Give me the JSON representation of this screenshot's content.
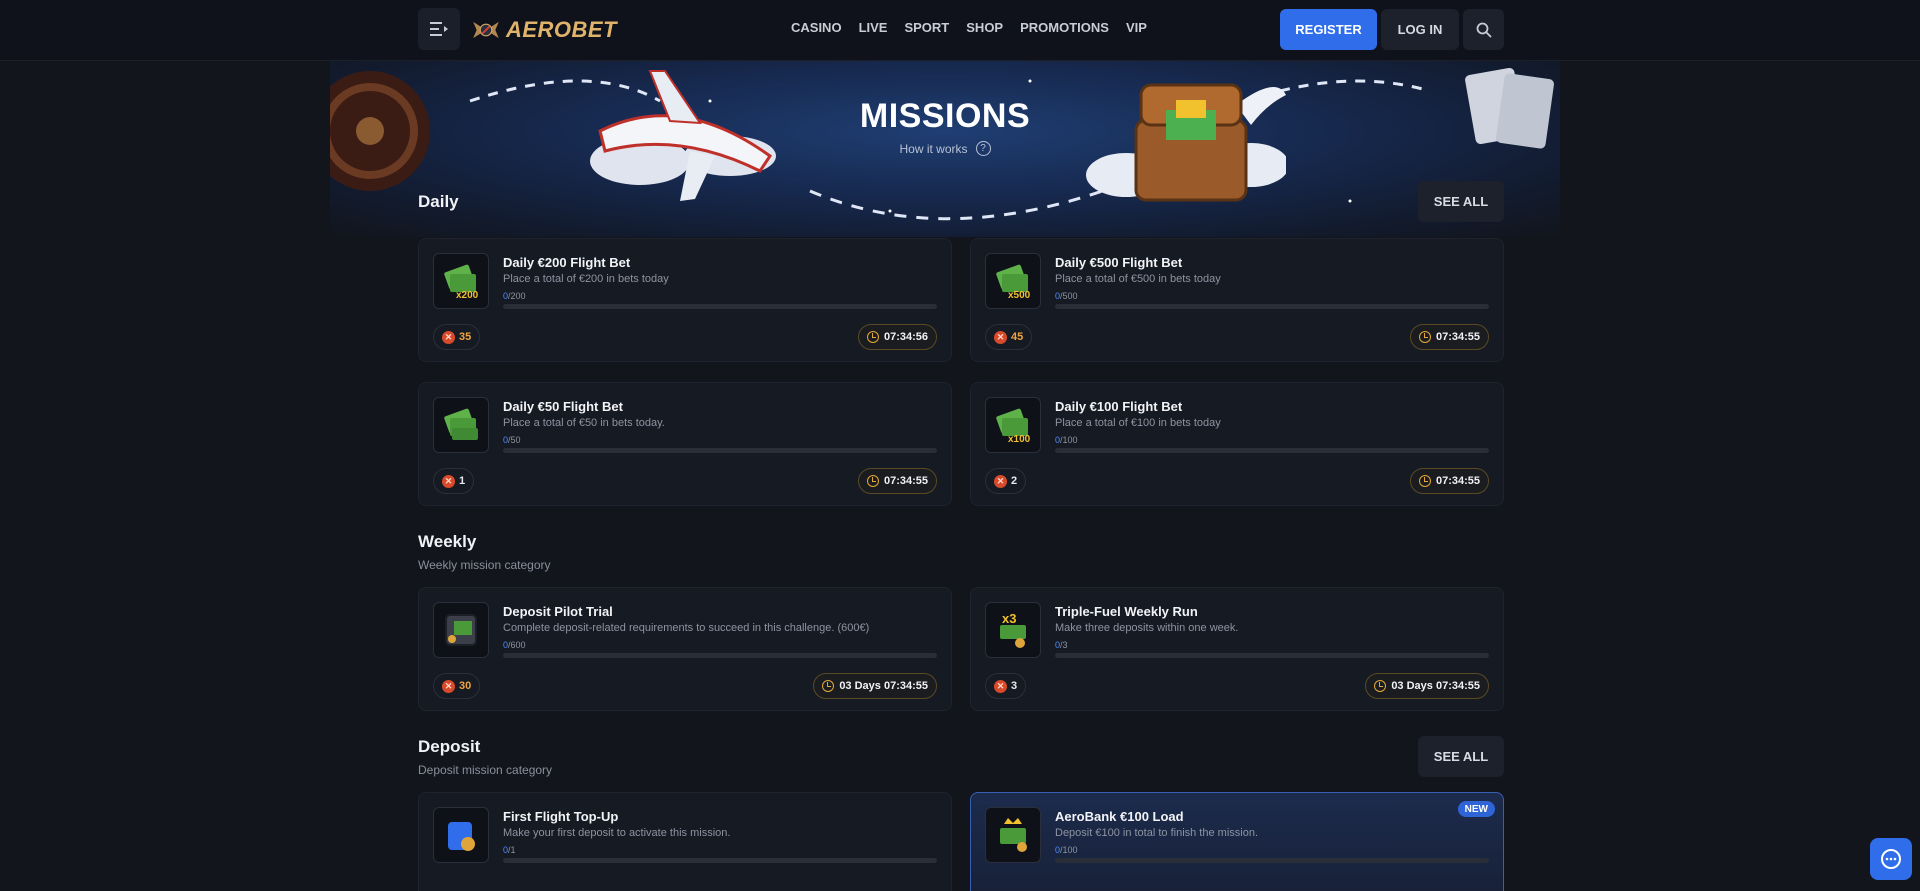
{
  "header": {
    "brand": "AEROBET",
    "nav": [
      "CASINO",
      "LIVE",
      "SPORT",
      "SHOP",
      "PROMOTIONS",
      "VIP"
    ],
    "register_label": "REGISTER",
    "login_label": "LOG IN"
  },
  "hero": {
    "title": "MISSIONS",
    "how_it_works": "How it works"
  },
  "sections": {
    "daily": {
      "title": "Daily",
      "see_all": "SEE ALL",
      "cards": [
        {
          "title": "Daily €200 Flight Bet",
          "desc": "Place a total of €200 in bets today",
          "done": "0",
          "total": "/200",
          "progress": 0,
          "points": "35",
          "timer": "07:34:56",
          "icon": "cash-x200-icon",
          "multiplier": "x200"
        },
        {
          "title": "Daily €500 Flight Bet",
          "desc": "Place a total of €500 in bets today",
          "done": "0",
          "total": "/500",
          "progress": 0,
          "points": "45",
          "timer": "07:34:55",
          "icon": "cash-x500-icon",
          "multiplier": "x500"
        },
        {
          "title": "Daily €50 Flight Bet",
          "desc": "Place a total of €50 in bets today.",
          "done": "0",
          "total": "/50",
          "progress": 0,
          "points": "1",
          "timer": "07:34:55",
          "icon": "cash-stack-icon",
          "multiplier": ""
        },
        {
          "title": "Daily €100 Flight Bet",
          "desc": "Place a total of €100 in bets today",
          "done": "0",
          "total": "/100",
          "progress": 0,
          "points": "2",
          "timer": "07:34:55",
          "icon": "cash-x100-icon",
          "multiplier": "x100"
        }
      ]
    },
    "weekly": {
      "title": "Weekly",
      "subtitle": "Weekly mission category",
      "cards": [
        {
          "title": "Deposit Pilot Trial",
          "desc": "Complete deposit-related requirements to succeed in this challenge. (600€)",
          "done": "0",
          "total": "/600",
          "progress": 0,
          "points": "30",
          "timer": "03 Days 07:34:55",
          "icon": "safe-icon"
        },
        {
          "title": "Triple-Fuel Weekly Run",
          "desc": "Make three deposits within one week.",
          "done": "0",
          "total": "/3",
          "progress": 0,
          "points": "3",
          "timer": "03 Days 07:34:55",
          "icon": "cash-x3-icon",
          "multiplier": "x3"
        }
      ]
    },
    "deposit": {
      "title": "Deposit",
      "subtitle": "Deposit mission category",
      "see_all": "SEE ALL",
      "cards": [
        {
          "title": "First Flight Top-Up",
          "desc": "Make your first deposit to activate this mission.",
          "done": "0",
          "total": "/1",
          "progress": 0,
          "icon": "wallet-1st-icon"
        },
        {
          "title": "AeroBank €100 Load",
          "desc": "Deposit €100 in total to finish the mission.",
          "done": "0",
          "total": "/100",
          "progress": 0,
          "badge": "NEW",
          "icon": "cash-crown-icon"
        }
      ]
    }
  },
  "colors": {
    "accent": "#2f6dea",
    "background": "#12151c",
    "card": "#161a23",
    "points": "#f0a341",
    "timer_ring": "#e3a73a"
  }
}
